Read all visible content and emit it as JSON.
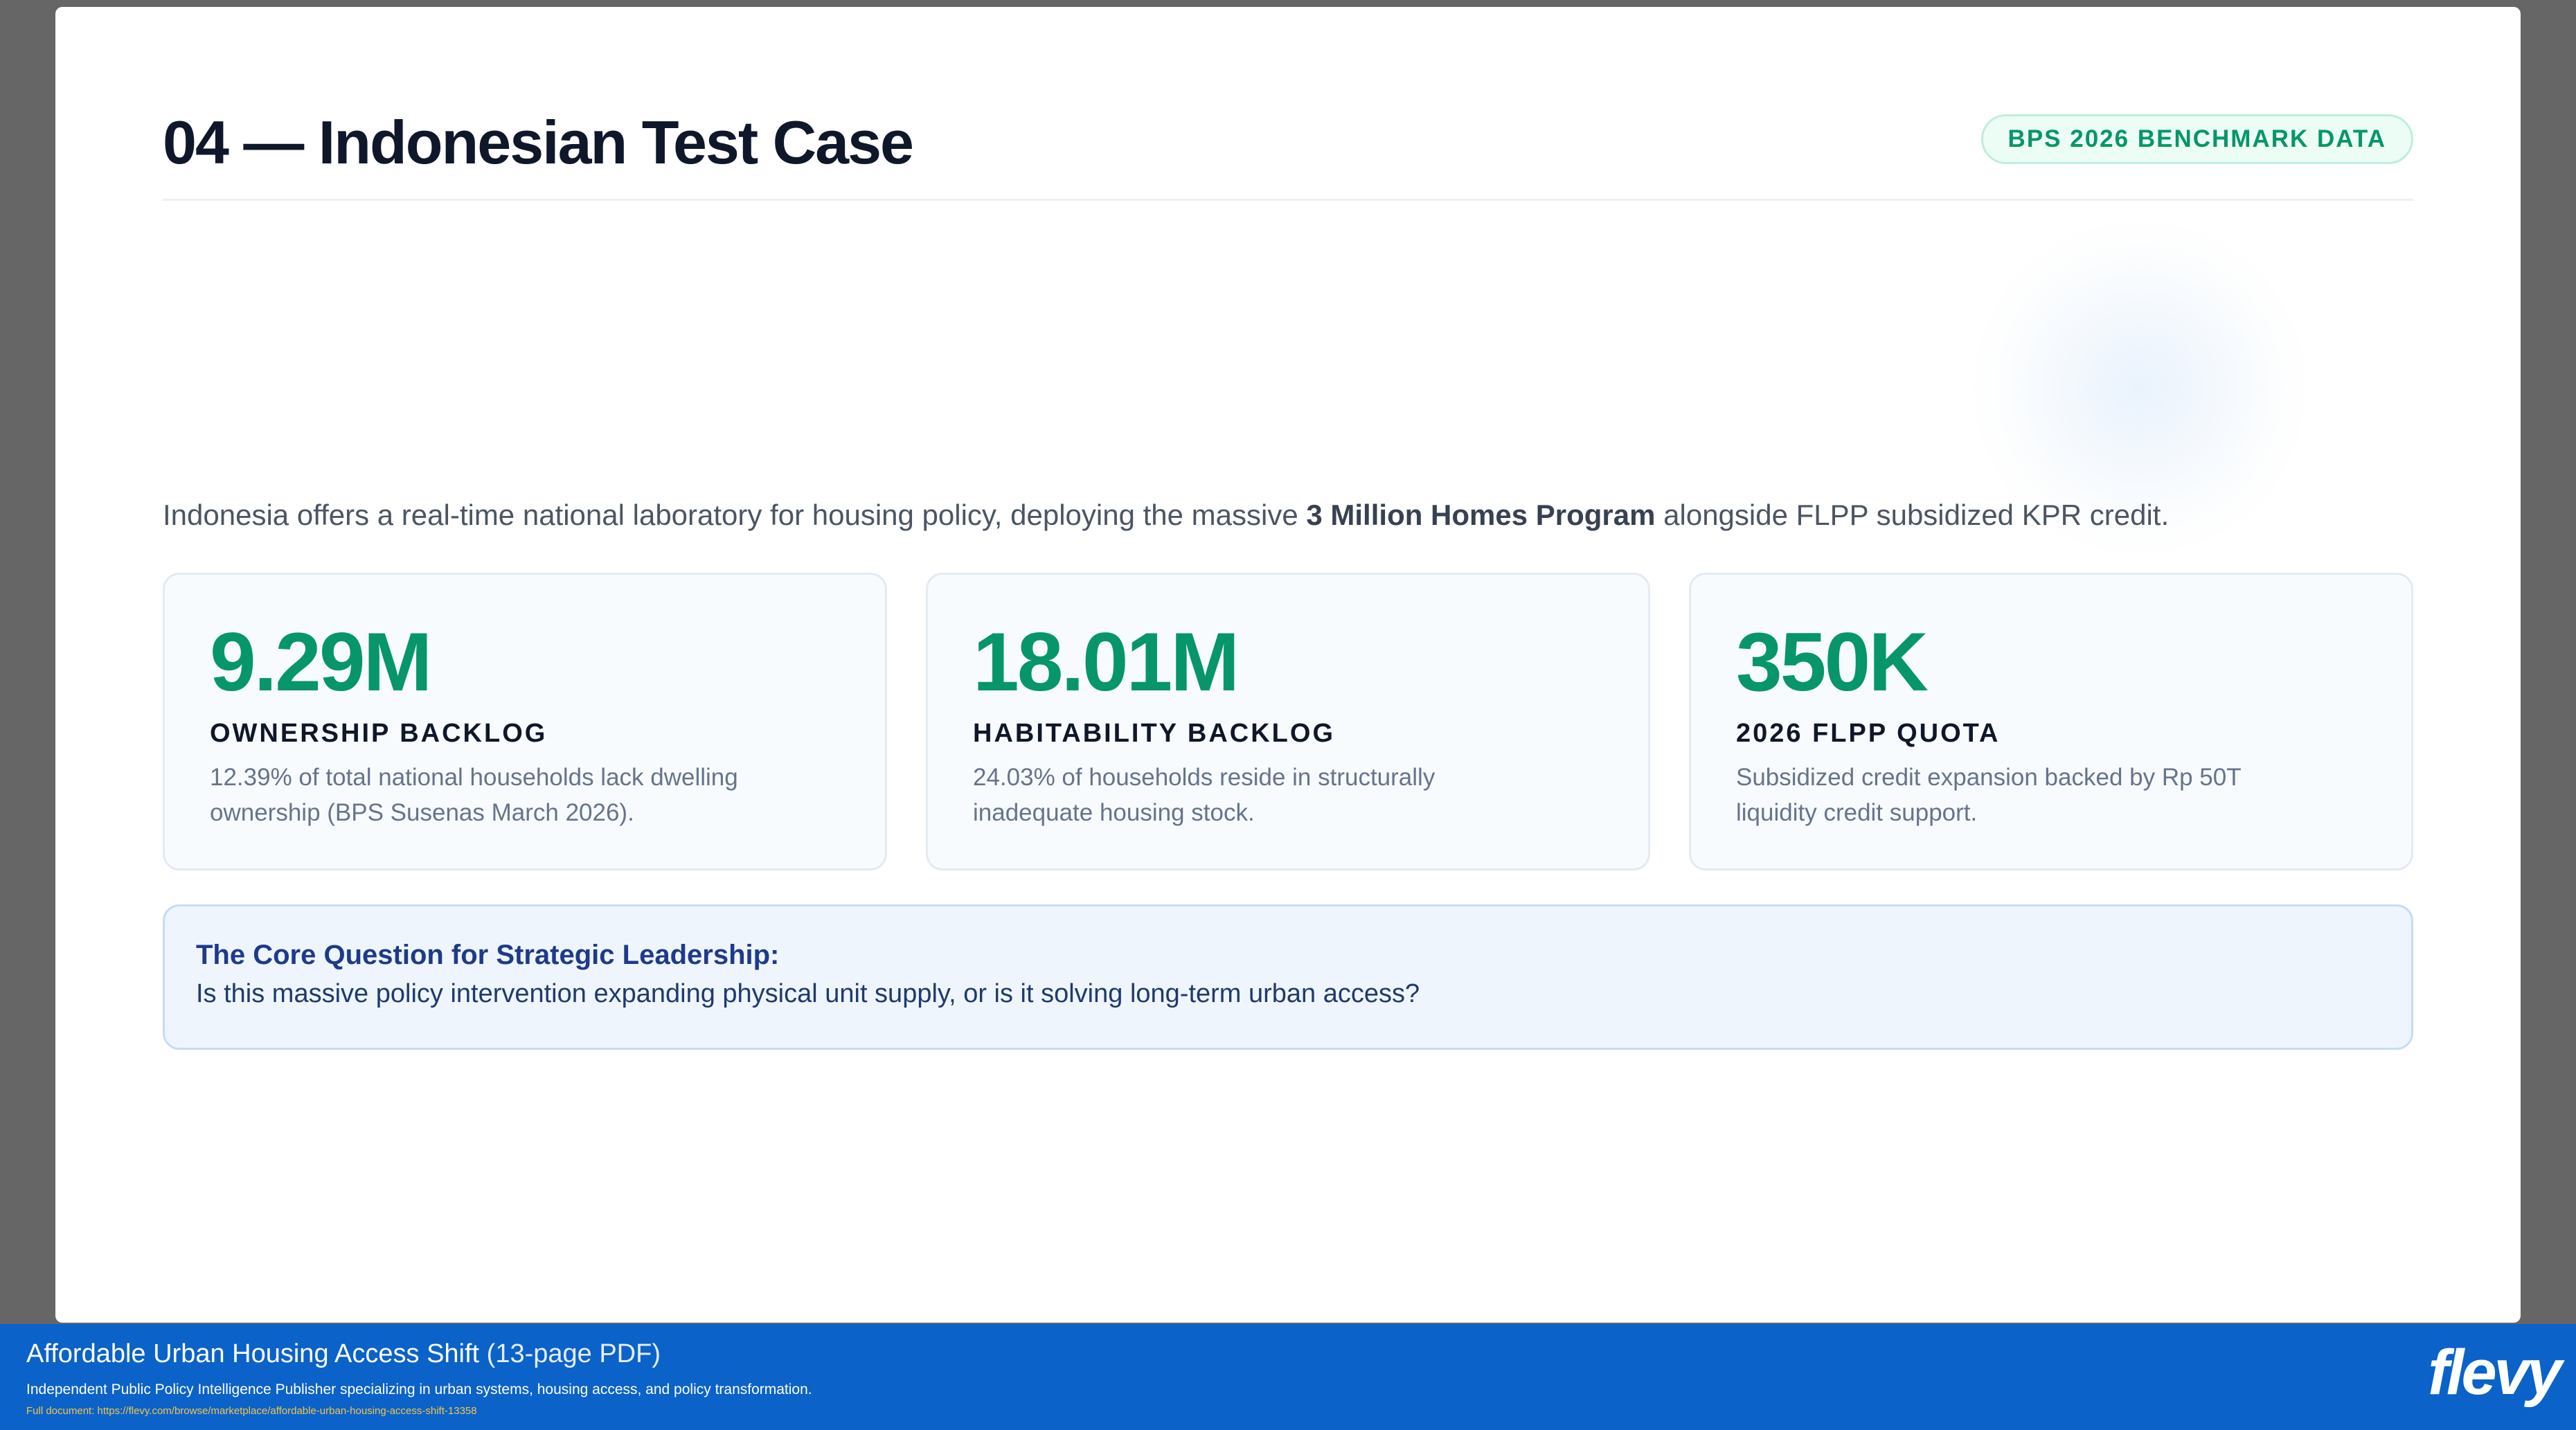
{
  "slide": {
    "title": "04 — Indonesian Test Case",
    "badge": "BPS 2026 BENCHMARK DATA",
    "intro": {
      "before": "Indonesia offers a real-time national laboratory for housing policy, deploying the massive ",
      "highlight": "3 Million Homes Program",
      "after": " alongside FLPP subsidized KPR credit."
    },
    "cards": [
      {
        "metric": "9.29M",
        "label": "OWNERSHIP BACKLOG",
        "desc_line1": "12.39% of total national households lack dwelling",
        "desc_line2": "ownership (BPS Susenas March 2026)."
      },
      {
        "metric": "18.01M",
        "label": "HABITABILITY BACKLOG",
        "desc_line1": "24.03% of households reside in structurally",
        "desc_line2": "inadequate housing stock."
      },
      {
        "metric": "350K",
        "label": "2026 FLPP QUOTA",
        "desc_line1": "Subsidized credit expansion backed by Rp 50T",
        "desc_line2": "liquidity credit support."
      }
    ],
    "question": {
      "title": "The Core Question for Strategic Leadership:",
      "text": "Is this massive policy intervention expanding physical unit supply, or is it solving long-term urban access?"
    }
  },
  "footer": {
    "doc_title": "Affordable Urban Housing Access Shift",
    "pages": "(13-page PDF)",
    "subtitle": "Independent Public Policy Intelligence Publisher specializing in urban systems, housing access, and policy transformation.",
    "link": "Full document: https://flevy.com/browse/marketplace/affordable-urban-housing-access-shift-13358",
    "logo": "flevy"
  },
  "colors": {
    "accent_green": "#079669",
    "title_navy": "#0f172a",
    "question_blue": "#1e3a8a",
    "footer_blue": "#0b62c9",
    "link_yellow": "#f6c544"
  }
}
